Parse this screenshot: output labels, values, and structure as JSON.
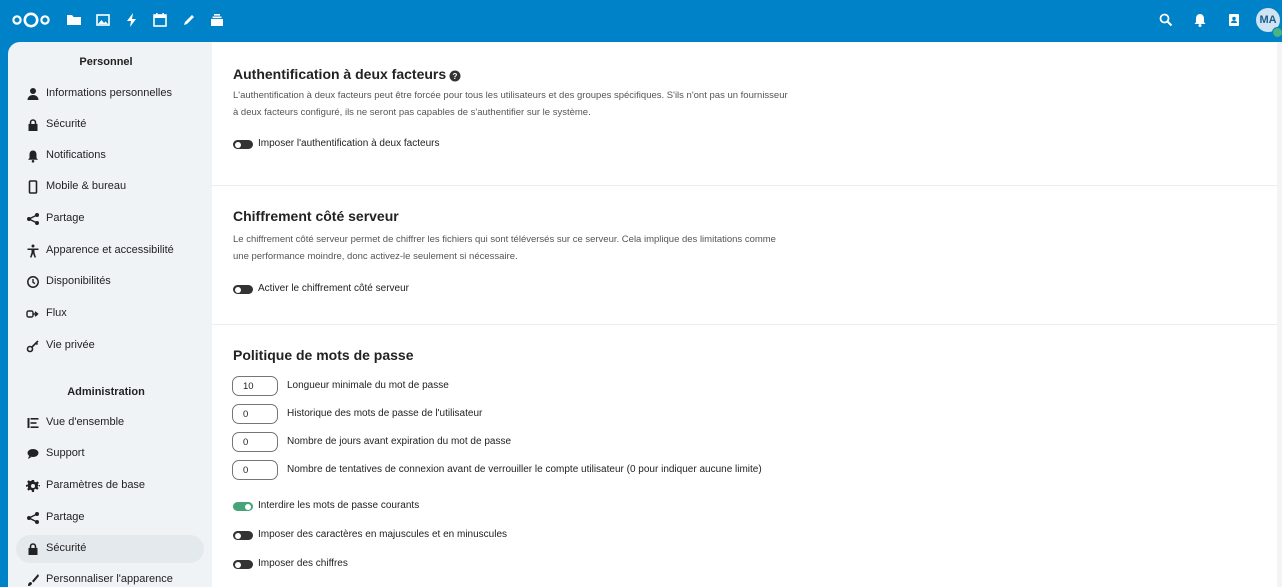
{
  "header": {
    "avatar_initials": "MA",
    "accent_color": "#0082c9",
    "apps": [
      "files-icon",
      "photos-icon",
      "activity-icon",
      "calendar-icon",
      "notes-icon",
      "deck-icon"
    ],
    "right_icons": [
      "search-icon",
      "bell-icon",
      "contacts-icon"
    ]
  },
  "sidebar": {
    "personal_heading": "Personnel",
    "personal_items": [
      {
        "label": "Informations personnelles",
        "icon": "user-icon"
      },
      {
        "label": "Sécurité",
        "icon": "lock-icon"
      },
      {
        "label": "Notifications",
        "icon": "bell-icon"
      },
      {
        "label": "Mobile & bureau",
        "icon": "phone-icon"
      },
      {
        "label": "Partage",
        "icon": "share-icon"
      },
      {
        "label": "Apparence et accessibilité",
        "icon": "accessibility-icon"
      },
      {
        "label": "Disponibilités",
        "icon": "clock-icon"
      },
      {
        "label": "Flux",
        "icon": "flow-icon"
      },
      {
        "label": "Vie privée",
        "icon": "key-icon"
      }
    ],
    "admin_heading": "Administration",
    "admin_items": [
      {
        "label": "Vue d'ensemble",
        "icon": "list-icon"
      },
      {
        "label": "Support",
        "icon": "chat-icon"
      },
      {
        "label": "Paramètres de base",
        "icon": "gear-icon"
      },
      {
        "label": "Partage",
        "icon": "share-icon"
      },
      {
        "label": "Sécurité",
        "icon": "lock-icon"
      },
      {
        "label": "Personnaliser l'apparence",
        "icon": "brush-icon"
      }
    ]
  },
  "main": {
    "twofa": {
      "title": "Authentification à deux facteurs",
      "desc_line1": "L'authentification à deux facteurs peut être forcée pour tous les utilisateurs et des groupes spécifiques. S'ils n'ont pas un fournisseur",
      "desc_line2": "à deux facteurs configuré, ils ne seront pas capables de s'authentifier sur le système.",
      "toggle_label": "Imposer l'authentification à deux facteurs",
      "toggle_on": false
    },
    "encryption": {
      "title": "Chiffrement côté serveur",
      "desc_line1": "Le chiffrement côté serveur permet de chiffrer les fichiers qui sont téléversés sur ce serveur. Cela implique des limitations comme",
      "desc_line2": "une performance moindre, donc activez-le seulement si nécessaire.",
      "toggle_label": "Activer le chiffrement côté serveur",
      "toggle_on": false
    },
    "password_policy": {
      "title": "Politique de mots de passe",
      "fields": [
        {
          "value": "10",
          "label": "Longueur minimale du mot de passe"
        },
        {
          "value": "0",
          "label": "Historique des mots de passe de l'utilisateur"
        },
        {
          "value": "0",
          "label": "Nombre de jours avant expiration du mot de passe"
        },
        {
          "value": "0",
          "label": "Nombre de tentatives de connexion avant de verrouiller le compte utilisateur (0 pour indiquer aucune limite)"
        }
      ],
      "toggles": [
        {
          "label": "Interdire les mots de passe courants",
          "on": true
        },
        {
          "label": "Imposer des caractères en majuscules et en minuscules",
          "on": false
        },
        {
          "label": "Imposer des chiffres",
          "on": false
        }
      ]
    }
  }
}
